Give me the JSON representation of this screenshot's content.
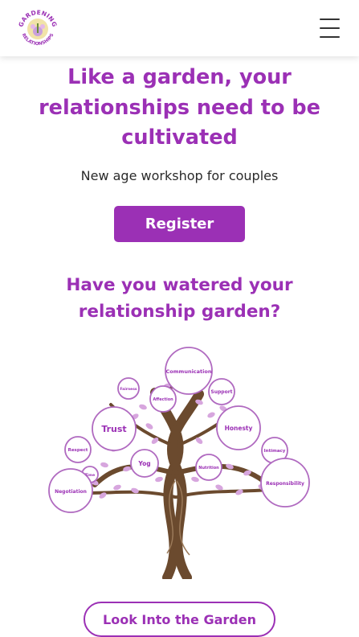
{
  "header": {
    "logo_top_text": "GARDENING",
    "logo_bottom_text": "RELATIONSHIPS",
    "menu_icon": "hamburger-icon"
  },
  "hero": {
    "title": "Like a garden, your relationships need to be cultivated",
    "subtitle": "New age workshop for couples",
    "register_label": "Register"
  },
  "garden_section": {
    "title": "Have you watered your relationship garden?",
    "tree_labels": {
      "communication": "Communication",
      "fairness": "Fairness",
      "affection": "Affection",
      "support": "Support",
      "trust": "Trust",
      "honesty": "Honesty",
      "respect": "Respect",
      "yog": "Yog",
      "intimacy": "Intimacy",
      "time": "Time",
      "nutrition": "Nutrition",
      "negotiation": "Negotiation",
      "responsibility": "Responsibility"
    },
    "look_button_label": "Look Into the Garden"
  },
  "colors": {
    "brand": "#9b30b5",
    "trunk": "#6b4a2e",
    "leaf": "#d7a6de"
  }
}
